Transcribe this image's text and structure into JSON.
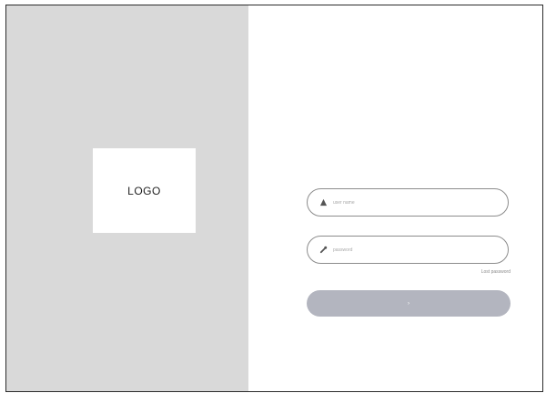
{
  "logo": {
    "text": "LOGO"
  },
  "form": {
    "username": {
      "placeholder": "user name",
      "icon": "user-icon"
    },
    "password": {
      "placeholder": "password",
      "icon": "key-icon"
    },
    "forgot_label": "Lost password",
    "submit_label": "›"
  },
  "colors": {
    "left_panel": "#d9d9d9",
    "field_border": "#8c8c8c",
    "button": "#b3b5bf"
  }
}
